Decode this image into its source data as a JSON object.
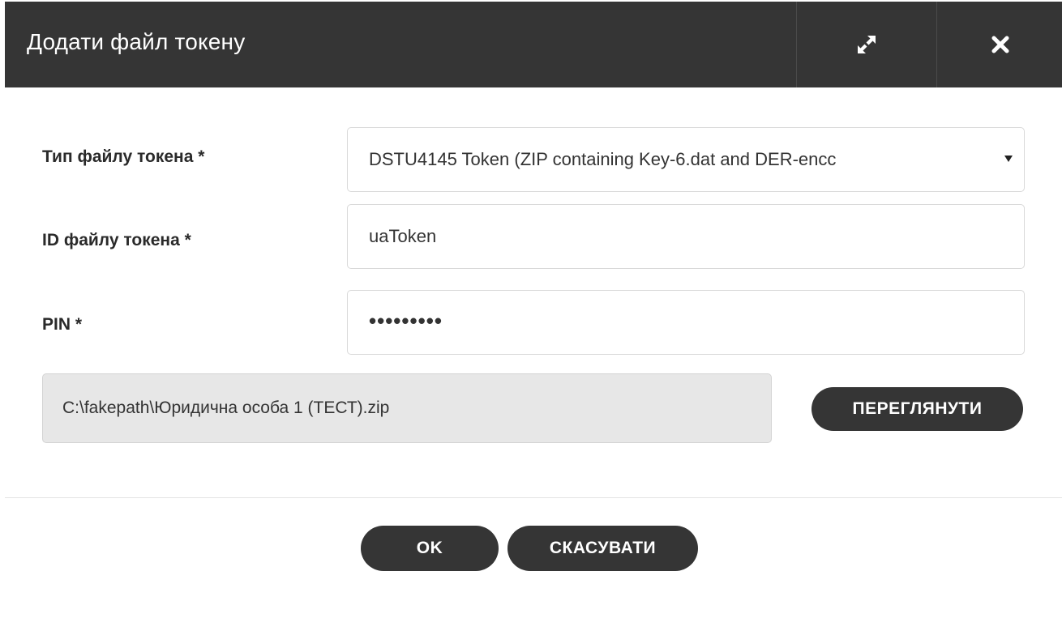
{
  "dialog": {
    "title": "Додати файл токену",
    "expand_icon": "expand-icon",
    "close_icon": "close-icon"
  },
  "form": {
    "token_type": {
      "label": "Тип файлу токена *",
      "selected_value": "DSTU4145 Token (ZIP containing Key-6.dat and DER-encc"
    },
    "token_id": {
      "label": "ID файлу токена *",
      "value": "uaToken"
    },
    "pin": {
      "label": "PIN *",
      "value": "•••••••••"
    },
    "file": {
      "path": "C:\\fakepath\\Юридична особа 1 (ТЕСТ).zip",
      "browse_label": "ПЕРЕГЛЯНУТИ"
    }
  },
  "footer": {
    "ok_label": "OK",
    "cancel_label": "СКАСУВАТИ"
  },
  "colors": {
    "header_bg": "#353535",
    "button_bg": "#353535",
    "file_field_bg": "#e7e7e7"
  }
}
